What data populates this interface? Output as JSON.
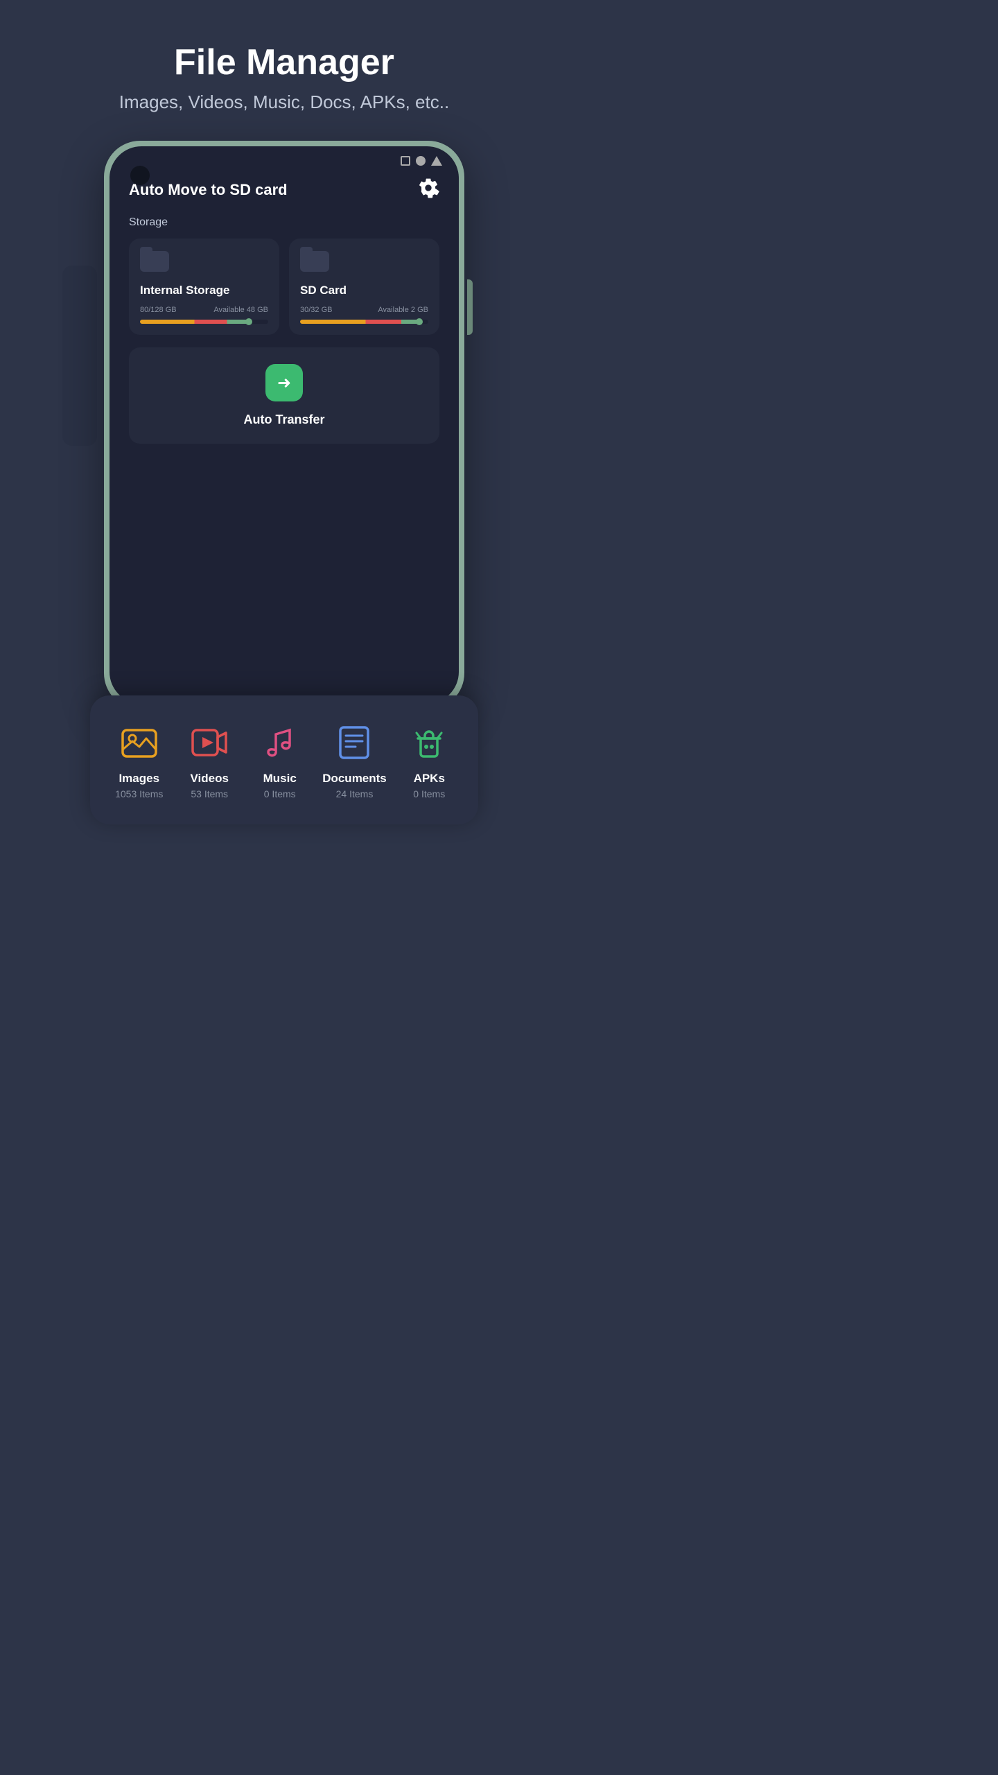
{
  "header": {
    "title": "File Manager",
    "subtitle": "Images, Videos, Music, Docs, APKs, etc.."
  },
  "app": {
    "title": "Auto Move to SD card",
    "storage_label": "Storage",
    "internal": {
      "name": "Internal Storage",
      "used": "80/128 GB",
      "available": "Available 48 GB"
    },
    "sdcard": {
      "name": "SD Card",
      "used": "30/32 GB",
      "available": "Available 2 GB"
    },
    "transfer": {
      "label": "Auto Transfer"
    }
  },
  "categories": [
    {
      "name": "Images",
      "count": "1053 Items",
      "icon": "images"
    },
    {
      "name": "Videos",
      "count": "53 Items",
      "icon": "videos"
    },
    {
      "name": "Music",
      "count": "0 Items",
      "icon": "music"
    },
    {
      "name": "Documents",
      "count": "24 Items",
      "icon": "docs"
    },
    {
      "name": "APKs",
      "count": "0 Items",
      "icon": "apks"
    }
  ]
}
